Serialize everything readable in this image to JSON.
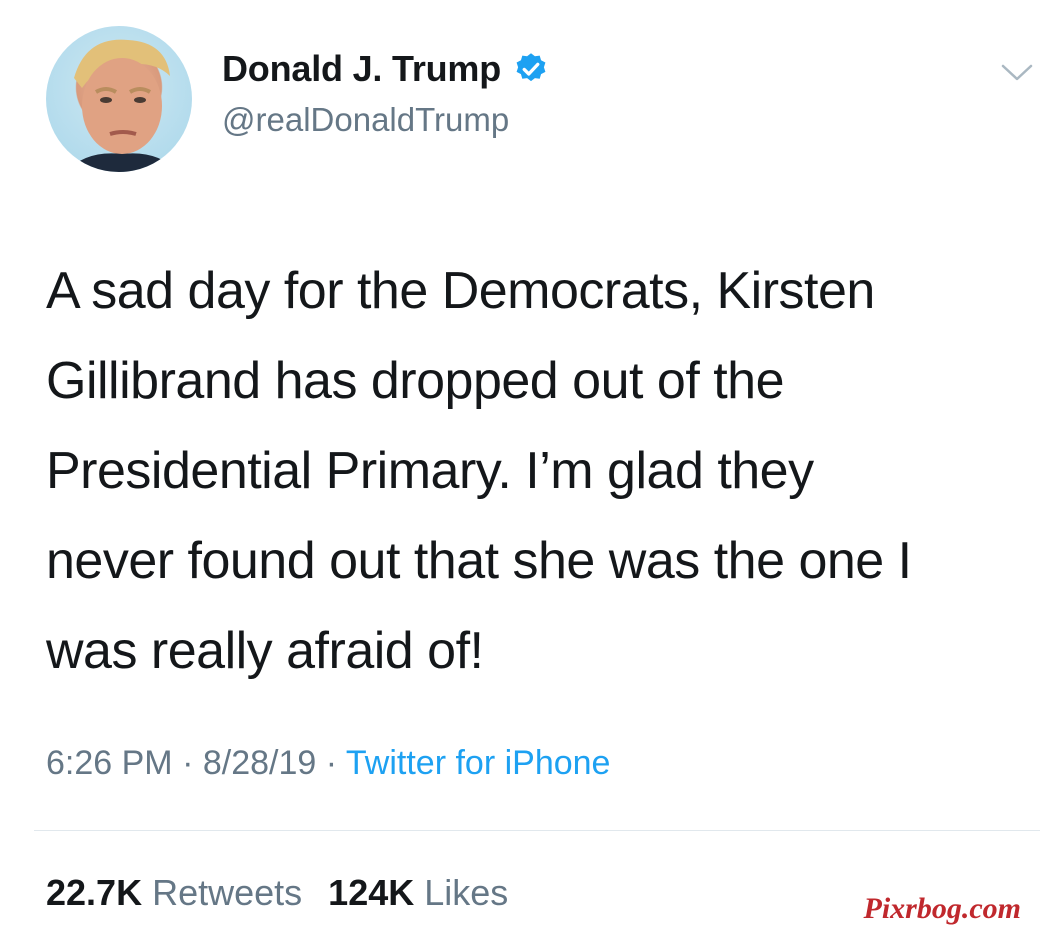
{
  "user": {
    "display_name": "Donald J. Trump",
    "handle": "@realDonaldTrump",
    "verified": true,
    "avatar_icon": "profile-photo"
  },
  "tweet": {
    "text_lines": [
      "A sad day for the Democrats, Kirsten",
      "Gillibrand has dropped out of the",
      "Presidential Primary. I’m glad they",
      "never found out that she was the one I",
      "was really afraid of!"
    ]
  },
  "meta": {
    "time": "6:26 PM",
    "separator": " · ",
    "date": "8/28/19",
    "source": "Twitter for iPhone"
  },
  "stats": {
    "retweets_count": "22.7K",
    "retweets_label": "Retweets",
    "likes_count": "124K",
    "likes_label": "Likes"
  },
  "watermark": "Pixrbog.com",
  "colors": {
    "verified_badge": "#1da1f2",
    "link": "#1da1f2",
    "secondary_text": "#657786",
    "watermark": "#c0282d"
  },
  "icons": {
    "menu": "chevron-down-icon",
    "verified": "verified-badge-icon"
  }
}
